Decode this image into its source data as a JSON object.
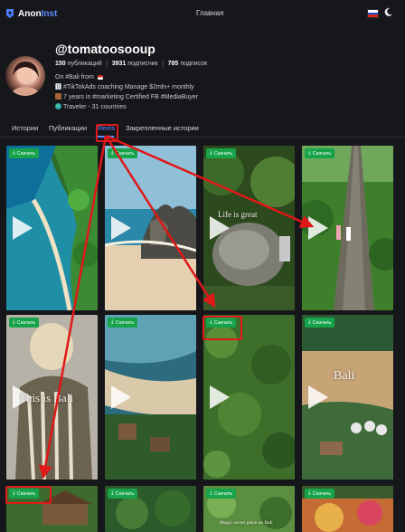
{
  "header": {
    "logo_anon": "Anon",
    "logo_inst": "Inst",
    "nav_home": "Главная"
  },
  "profile": {
    "username": "@tomatoosooup",
    "stats": [
      {
        "value": "150",
        "label": "публикаций"
      },
      {
        "value": "3931",
        "label": "подписчик"
      },
      {
        "value": "785",
        "label": "подписок"
      }
    ],
    "bio": [
      "On #Bali from",
      "#TikTokAds coaching  Manage $2mln+ monthly",
      "7 years in #marketing  Certified FB #MediaBuyer",
      "Traveler - 31 countries"
    ]
  },
  "tabs": [
    {
      "label": "Истории"
    },
    {
      "label": "Публикации"
    },
    {
      "label": "Reels",
      "active": true
    },
    {
      "label": "Закрепленные истории"
    }
  ],
  "download_label": "Скачать",
  "tile_overlays": {
    "t3": "Life is great",
    "t5": "This is Bali",
    "t8": "Bali",
    "t11": "Magic secret place on Bali"
  },
  "colors": {
    "background": "#16171b",
    "accent": "#5f8dff",
    "download_button": "#16a34a",
    "annotation_red": "#e01818"
  }
}
